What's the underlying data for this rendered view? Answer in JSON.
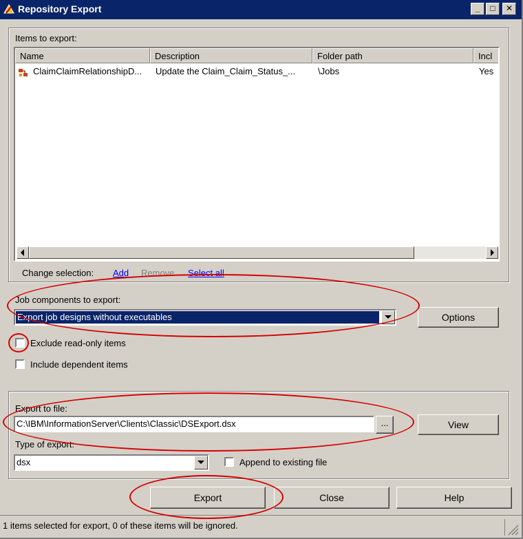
{
  "window": {
    "title": "Repository Export",
    "minimize_glyph": "_",
    "maximize_glyph": "□",
    "close_glyph": "✕"
  },
  "items": {
    "group_label": "Items to export:",
    "columns": [
      "Name",
      "Description",
      "Folder path",
      "Incl"
    ],
    "rows": [
      {
        "icon": "job-icon",
        "name": "ClaimClaimRelationshipD...",
        "description": "Update the Claim_Claim_Status_...",
        "folder_path": "\\Jobs",
        "included": "Yes"
      }
    ],
    "change_selection_label": "Change selection:",
    "add_link": "Add",
    "remove_link": "Remove",
    "select_all_link": "Select all"
  },
  "job_components": {
    "label": "Job components to export:",
    "selected": "Export job designs without executables",
    "options_button": "Options",
    "exclude_readonly_label": "Exclude read-only items",
    "exclude_readonly_checked": false,
    "include_dependent_label": "Include dependent items",
    "include_dependent_checked": false
  },
  "export_file": {
    "label": "Export to file:",
    "path": "C:\\IBM\\InformationServer\\Clients\\Classic\\DSExport.dsx",
    "browse_button": "...",
    "view_button": "View",
    "type_label": "Type of export:",
    "type_selected": "dsx",
    "append_label": "Append to existing file",
    "append_checked": false
  },
  "buttons": {
    "export": "Export",
    "close": "Close",
    "help": "Help"
  },
  "status_bar": {
    "text": "1 items selected for export, 0 of these items will be ignored."
  },
  "colors": {
    "title_bar": "#0a246a",
    "selection": "#0a246a",
    "annotation": "#d40000",
    "link": "#0000ff"
  }
}
